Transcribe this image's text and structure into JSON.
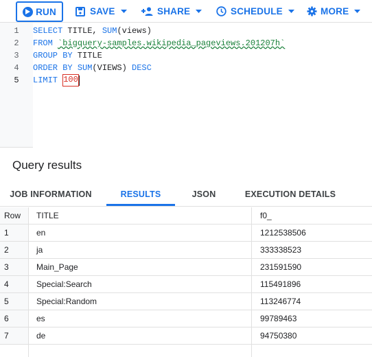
{
  "toolbar": {
    "run_label": "RUN",
    "save_label": "SAVE",
    "share_label": "SHARE",
    "schedule_label": "SCHEDULE",
    "more_label": "MORE",
    "accent_color": "#1a73e8"
  },
  "editor": {
    "line_numbers": [
      "1",
      "2",
      "3",
      "4",
      "5"
    ],
    "lines": [
      {
        "t1": "SELECT",
        "t2": " TITLE, ",
        "t3": "SUM",
        "t4": "(views)"
      },
      {
        "t1": "FROM",
        "t2": " ",
        "t3": "`bigquery-samples.wikipedia_pageviews.201207h`"
      },
      {
        "t1": "GROUP BY",
        "t2": " TITLE"
      },
      {
        "t1": "ORDER BY",
        "t2": " ",
        "t3": "SUM",
        "t4": "(VIEWS) ",
        "t5": "DESC"
      },
      {
        "t1": "LIMIT",
        "t2": " ",
        "t3": "100"
      }
    ]
  },
  "results": {
    "title": "Query results",
    "tabs": [
      "JOB INFORMATION",
      "RESULTS",
      "JSON",
      "EXECUTION DETAILS"
    ],
    "active_tab": "RESULTS",
    "columns": [
      "Row",
      "TITLE",
      "f0_"
    ],
    "rows": [
      {
        "row": "1",
        "title": "en",
        "f0": "1212538506"
      },
      {
        "row": "2",
        "title": "ja",
        "f0": "333338523"
      },
      {
        "row": "3",
        "title": "Main_Page",
        "f0": "231591590"
      },
      {
        "row": "4",
        "title": "Special:Search",
        "f0": "115491896"
      },
      {
        "row": "5",
        "title": "Special:Random",
        "f0": "113246774"
      },
      {
        "row": "6",
        "title": "es",
        "f0": "99789463"
      },
      {
        "row": "7",
        "title": "de",
        "f0": "94750380"
      }
    ]
  }
}
